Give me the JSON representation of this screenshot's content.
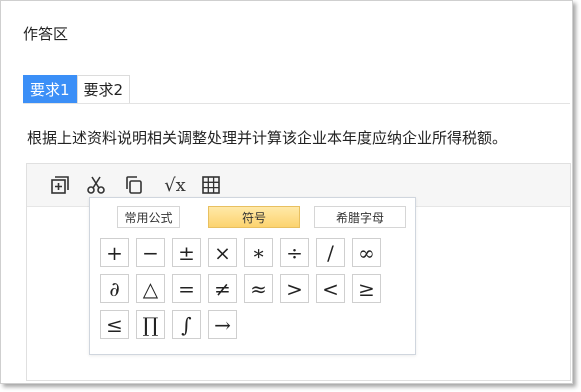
{
  "panel": {
    "title": "作答区",
    "tabs": [
      {
        "label": "要求1",
        "active": true
      },
      {
        "label": "要求2",
        "active": false
      }
    ],
    "question": "根据上述资料说明相关调整处理并计算该企业本年度应纳企业所得税额。"
  },
  "toolbar": {
    "icons": [
      "add-box-icon",
      "scissors-icon",
      "copy-icon",
      "sqrt-icon",
      "table-icon"
    ],
    "sqrt_label": "√x"
  },
  "symbol_popup": {
    "tabs": [
      {
        "label": "常用公式",
        "active": false
      },
      {
        "label": "符号",
        "active": true
      },
      {
        "label": "希腊字母",
        "active": false
      }
    ],
    "symbols": [
      "+",
      "−",
      "±",
      "×",
      "∗",
      "÷",
      "/",
      "∞",
      "∂",
      "△",
      "=",
      "≠",
      "≈",
      ">",
      "<",
      "≥",
      "≤",
      "∏",
      "∫",
      "→"
    ]
  },
  "colors": {
    "accent": "#3b8ff7",
    "active_symbol_tab": "#fcd36f"
  }
}
